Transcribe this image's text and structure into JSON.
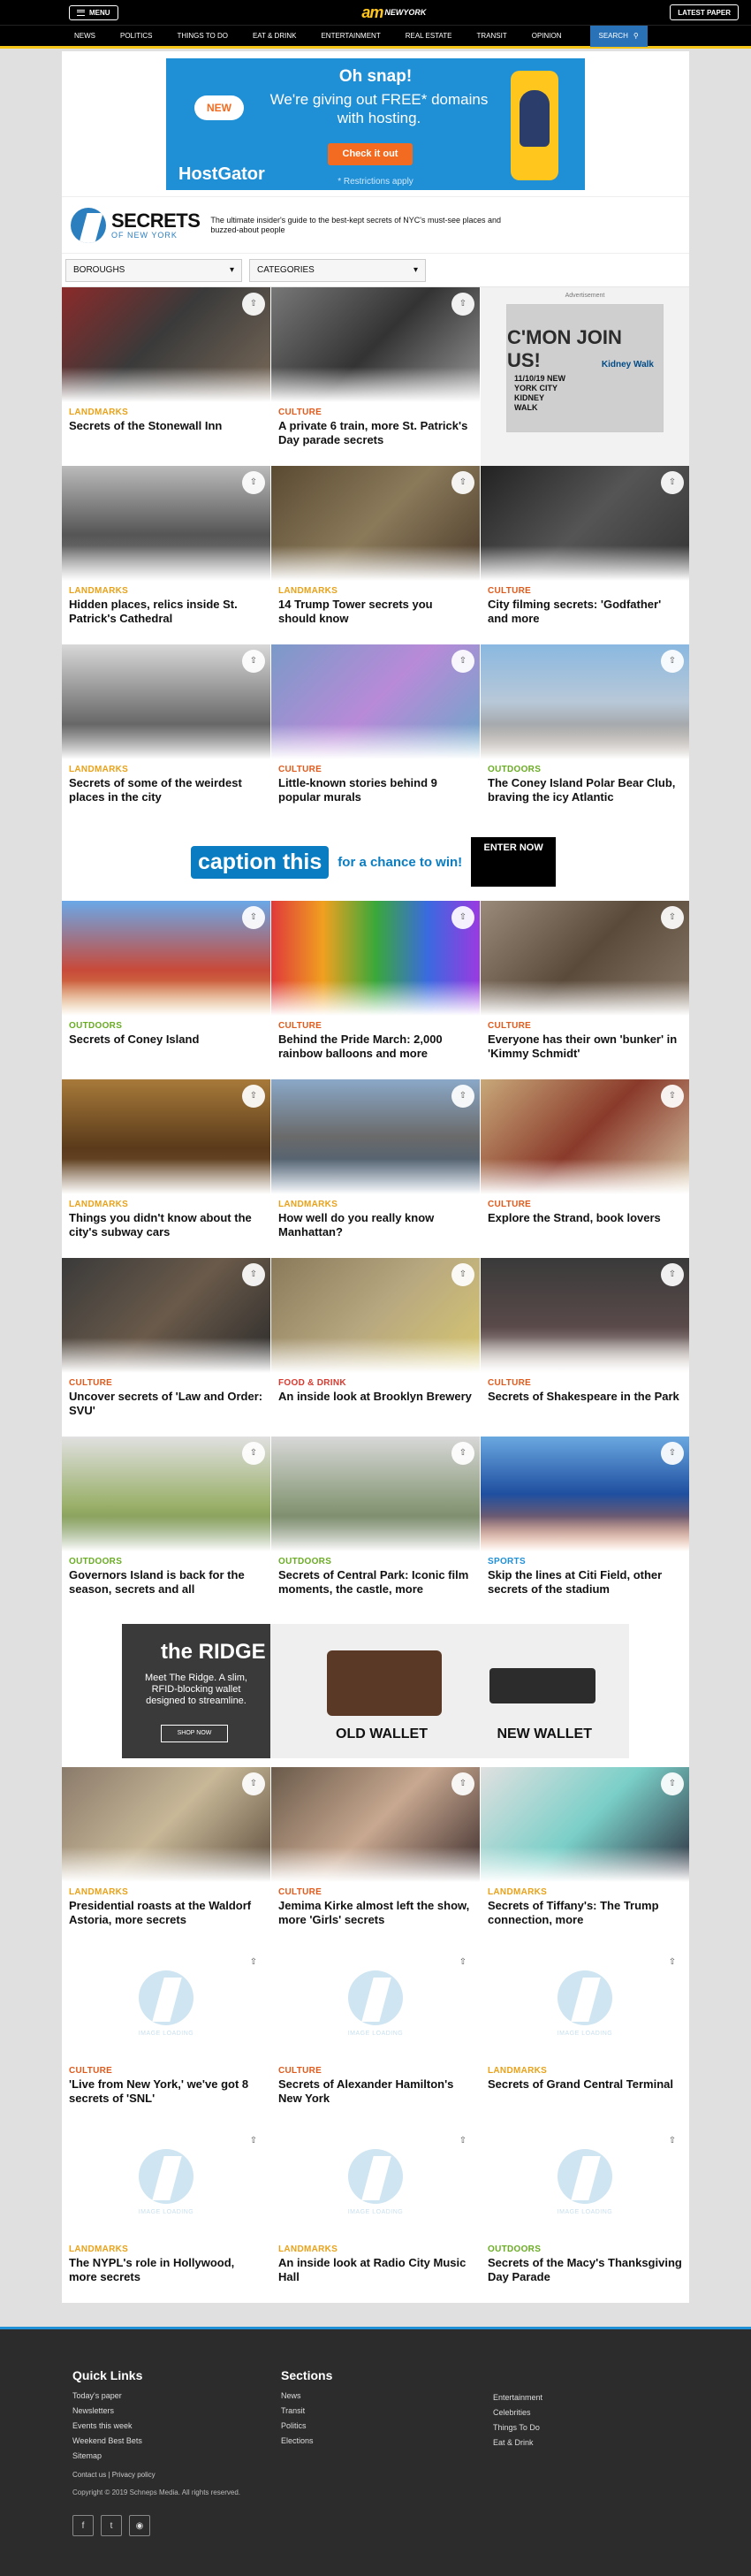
{
  "header": {
    "menu_label": "MENU",
    "logo_am": "am",
    "logo_ny": "NEWYORK",
    "latest_label": "LATEST PAPER"
  },
  "nav": {
    "items": [
      "NEWS",
      "POLITICS",
      "THINGS TO DO",
      "EAT & DRINK",
      "ENTERTAINMENT",
      "REAL ESTATE",
      "TRANSIT",
      "OPINION"
    ],
    "search_label": "SEARCH"
  },
  "ad_top": {
    "headline": "Oh snap!",
    "body": "We're giving out FREE* domains with hosting.",
    "cta": "Check it out",
    "fine": "* Restrictions apply",
    "badge": "NEW",
    "brand": "HostGator"
  },
  "secrets": {
    "title": "SECRETS",
    "subtitle": "OF NEW YORK",
    "description": "The ultimate insider's guide to the best-kept secrets of NYC's must-see places and buzzed-about people"
  },
  "filters": {
    "boroughs": "BOROUGHS",
    "categories": "CATEGORIES"
  },
  "side_ad": {
    "label": "Advertisement",
    "join": "C'MON JOIN US!",
    "date": "11/10/19 NEW YORK CITY KIDNEY WALK",
    "brand": "Kidney Walk"
  },
  "caption_ad": {
    "box": "caption this",
    "text": "for a chance to win!",
    "enter": "ENTER NOW"
  },
  "ridge_ad": {
    "brand": "the RIDGE",
    "copy": "Meet The Ridge. A slim, RFID-blocking wallet designed to streamline.",
    "shop": "SHOP NOW",
    "old": "OLD WALLET",
    "new": "NEW WALLET"
  },
  "colors": {
    "landmarks": "#e8a21a",
    "culture": "#e05a1c",
    "outdoors": "#6aab24",
    "food": "#d83a2f",
    "sports": "#1f8fd6"
  },
  "cards": [
    {
      "cat": "LANDMARKS",
      "title": "Secrets of the Stonewall Inn",
      "color": "#e8a21a",
      "img": "linear-gradient(135deg,#8b2a2a,#3a3a3a 45%,#7b6b5a)"
    },
    {
      "cat": "CULTURE",
      "title": "A private 6 train, more St. Patrick's Day parade secrets",
      "color": "#e05a1c",
      "img": "linear-gradient(135deg,#777,#333 50%,#999)"
    },
    {
      "cat": "LANDMARKS",
      "title": "Hidden places, relics inside St. Patrick's Cathedral",
      "color": "#e8a21a",
      "img": "linear-gradient(180deg,#bbb,#555 60%,#888)"
    },
    {
      "cat": "LANDMARKS",
      "title": "14 Trump Tower secrets you should know",
      "color": "#e8a21a",
      "img": "linear-gradient(135deg,#5a4a32,#8b7a5a 50%,#4a3a2a)"
    },
    {
      "cat": "CULTURE",
      "title": "City filming secrets: 'Godfather' and more",
      "color": "#e05a1c",
      "img": "linear-gradient(135deg,#222,#555 50%,#333)"
    },
    {
      "cat": "LANDMARKS",
      "title": "Secrets of some of the weirdest places in the city",
      "color": "#e8a21a",
      "img": "linear-gradient(180deg,#d8d8d8,#666 70%,#444)"
    },
    {
      "cat": "CULTURE",
      "title": "Little-known stories behind 9 popular murals",
      "color": "#e05a1c",
      "img": "linear-gradient(135deg,#7a9ac8,#b88ad8 50%,#6aa8c8)"
    },
    {
      "cat": "OUTDOORS",
      "title": "The Coney Island Polar Bear Club, braving the icy Atlantic",
      "color": "#6aab24",
      "img": "linear-gradient(180deg,#8ab8e0,#b8c8d8 50%,#8a7a6a)"
    },
    {
      "cat": "OUTDOORS",
      "title": "Secrets of Coney Island",
      "color": "#6aab24",
      "img": "linear-gradient(180deg,#6aa8e8,#c84a3a 60%,#d8a04a)"
    },
    {
      "cat": "CULTURE",
      "title": "Behind the Pride March: 2,000 rainbow balloons and more",
      "color": "#e05a1c",
      "img": "linear-gradient(90deg,#e03a3a,#f0a020,#3aa83a,#3a6ae0,#9a3ae0)"
    },
    {
      "cat": "CULTURE",
      "title": "Everyone has their own 'bunker' in 'Kimmy Schmidt'",
      "color": "#e05a1c",
      "img": "linear-gradient(135deg,#9a8a7a,#5a4a3a 50%,#8a7a6a)"
    },
    {
      "cat": "LANDMARKS",
      "title": "Things you didn't know about the city's subway cars",
      "color": "#e8a21a",
      "img": "linear-gradient(180deg,#a87a3a,#5a3a1a 60%,#7a5a3a)"
    },
    {
      "cat": "LANDMARKS",
      "title": "How well do you really know Manhattan?",
      "color": "#e8a21a",
      "img": "linear-gradient(180deg,#8aa8c8,#6a6a6a 50%,#3a5a7a)"
    },
    {
      "cat": "CULTURE",
      "title": "Explore the Strand, book lovers",
      "color": "#e05a1c",
      "img": "linear-gradient(135deg,#c8a87a,#8a3a2a 50%,#d8c8a8)"
    },
    {
      "cat": "CULTURE",
      "title": "Uncover secrets of 'Law and Order: SVU'",
      "color": "#e05a1c",
      "img": "linear-gradient(135deg,#3a3a3a,#6a5a4a 50%,#2a2a2a)"
    },
    {
      "cat": "FOOD & DRINK",
      "title": "An inside look at Brooklyn Brewery",
      "color": "#d83a2f",
      "img": "linear-gradient(135deg,#8a7a5a,#b8a880 50%,#d8c870)"
    },
    {
      "cat": "CULTURE",
      "title": "Secrets of Shakespeare in the Park",
      "color": "#e05a1c",
      "img": "linear-gradient(180deg,#3a3a3a,#5a4a4a 60%,#d8d0c8)"
    },
    {
      "cat": "OUTDOORS",
      "title": "Governors Island is back for the season, secrets and all",
      "color": "#6aab24",
      "img": "linear-gradient(180deg,#e0e0e0,#9ab06a 60%,#5a7a3a)"
    },
    {
      "cat": "OUTDOORS",
      "title": "Secrets of Central Park: Iconic film moments, the castle, more",
      "color": "#6aab24",
      "img": "linear-gradient(180deg,#d8d8d8,#8a9a7a 60%,#5a6a4a)"
    },
    {
      "cat": "SPORTS",
      "title": "Skip the lines at Citi Field, other secrets of the stadium",
      "color": "#1f8fd6",
      "img": "linear-gradient(180deg,#6aa8e0,#1f4fa0 50%,#e06a2a)"
    },
    {
      "cat": "LANDMARKS",
      "title": "Presidential roasts at the Waldorf Astoria, more secrets",
      "color": "#e8a21a",
      "img": "linear-gradient(135deg,#8a7a6a,#c8b898 50%,#5a4a3a)"
    },
    {
      "cat": "CULTURE",
      "title": "Jemima Kirke almost left the show, more 'Girls' secrets",
      "color": "#e05a1c",
      "img": "linear-gradient(135deg,#6a5a4a,#c8a890 50%,#3a2a2a)"
    },
    {
      "cat": "LANDMARKS",
      "title": "Secrets of Tiffany's: The Trump connection, more",
      "color": "#e8a21a",
      "img": "linear-gradient(135deg,#e0e0e0,#7acfc8 50%,#2a2a3a)"
    },
    {
      "cat": "CULTURE",
      "title": "'Live from New York,' we've got 8 secrets of 'SNL'",
      "color": "#e05a1c",
      "img": ""
    },
    {
      "cat": "CULTURE",
      "title": "Secrets of Alexander Hamilton's New York",
      "color": "#e05a1c",
      "img": ""
    },
    {
      "cat": "LANDMARKS",
      "title": "Secrets of Grand Central Terminal",
      "color": "#e8a21a",
      "img": ""
    },
    {
      "cat": "LANDMARKS",
      "title": "The NYPL's role in Hollywood, more secrets",
      "color": "#e8a21a",
      "img": ""
    },
    {
      "cat": "LANDMARKS",
      "title": "An inside look at Radio City Music Hall",
      "color": "#e8a21a",
      "img": ""
    },
    {
      "cat": "OUTDOORS",
      "title": "Secrets of the Macy's Thanksgiving Day Parade",
      "color": "#6aab24",
      "img": ""
    }
  ],
  "image_loading": "IMAGE LOADING",
  "footer": {
    "quick_links_title": "Quick Links",
    "quick_links": [
      "Today's paper",
      "Newsletters",
      "Events this week",
      "Weekend Best Bets",
      "Sitemap"
    ],
    "sections_title": "Sections",
    "sections": [
      "News",
      "Transit",
      "Politics",
      "Elections"
    ],
    "more": [
      "Entertainment",
      "Celebrities",
      "Things To Do",
      "Eat & Drink"
    ],
    "legal": "Contact us | Privacy policy",
    "copyright": "Copyright © 2019 Schneps Media. All rights reserved."
  }
}
